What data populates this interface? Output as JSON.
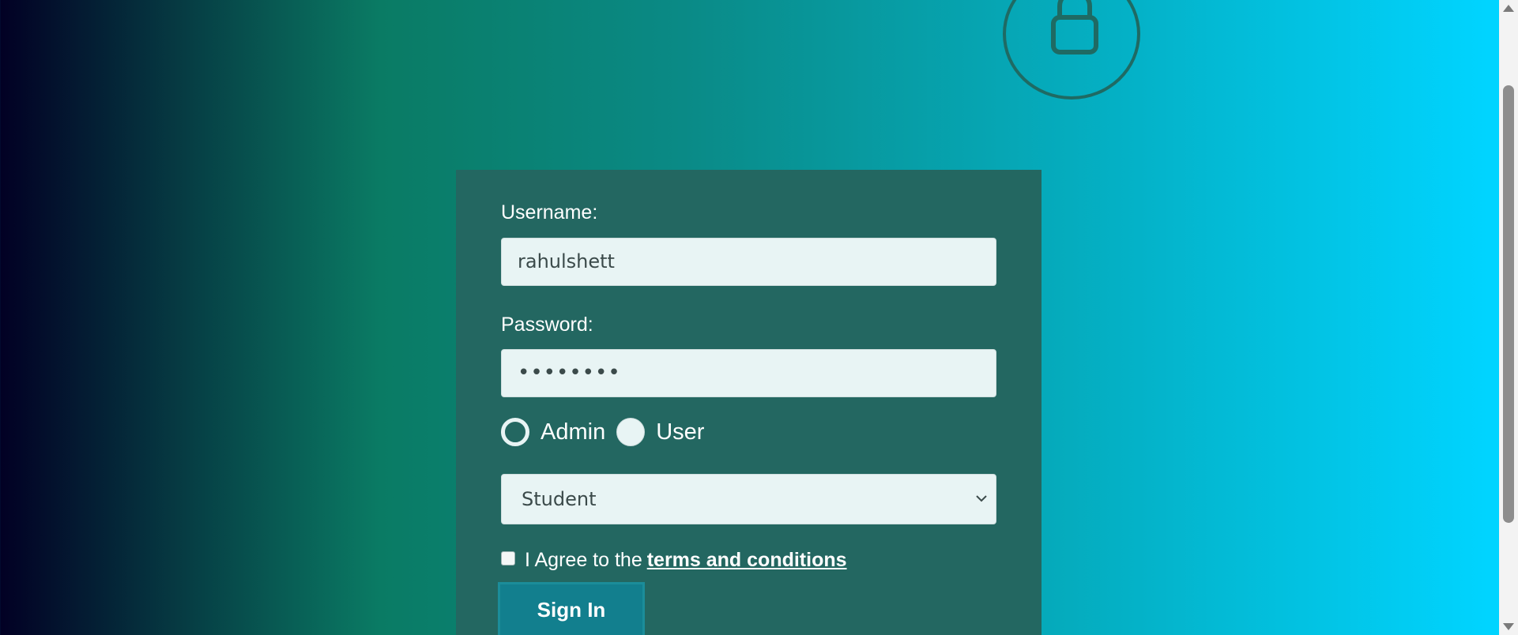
{
  "header": {
    "icon": "lock-icon"
  },
  "form": {
    "username_label": "Username:",
    "username_value": "rahulshett",
    "password_label": "Password:",
    "password_value": "••••••••",
    "roles": [
      {
        "label": "Admin",
        "selected": true
      },
      {
        "label": "User",
        "selected": false
      }
    ],
    "dropdown_selected": "Student",
    "agree_text": "I Agree to the",
    "terms_link": "terms and conditions",
    "terms_checked": false,
    "signin_label": "Sign In"
  },
  "colors": {
    "card_background": "#236761",
    "button_background": "#127f8e",
    "gradient_start": "#020024",
    "gradient_end": "#00d4ff"
  }
}
